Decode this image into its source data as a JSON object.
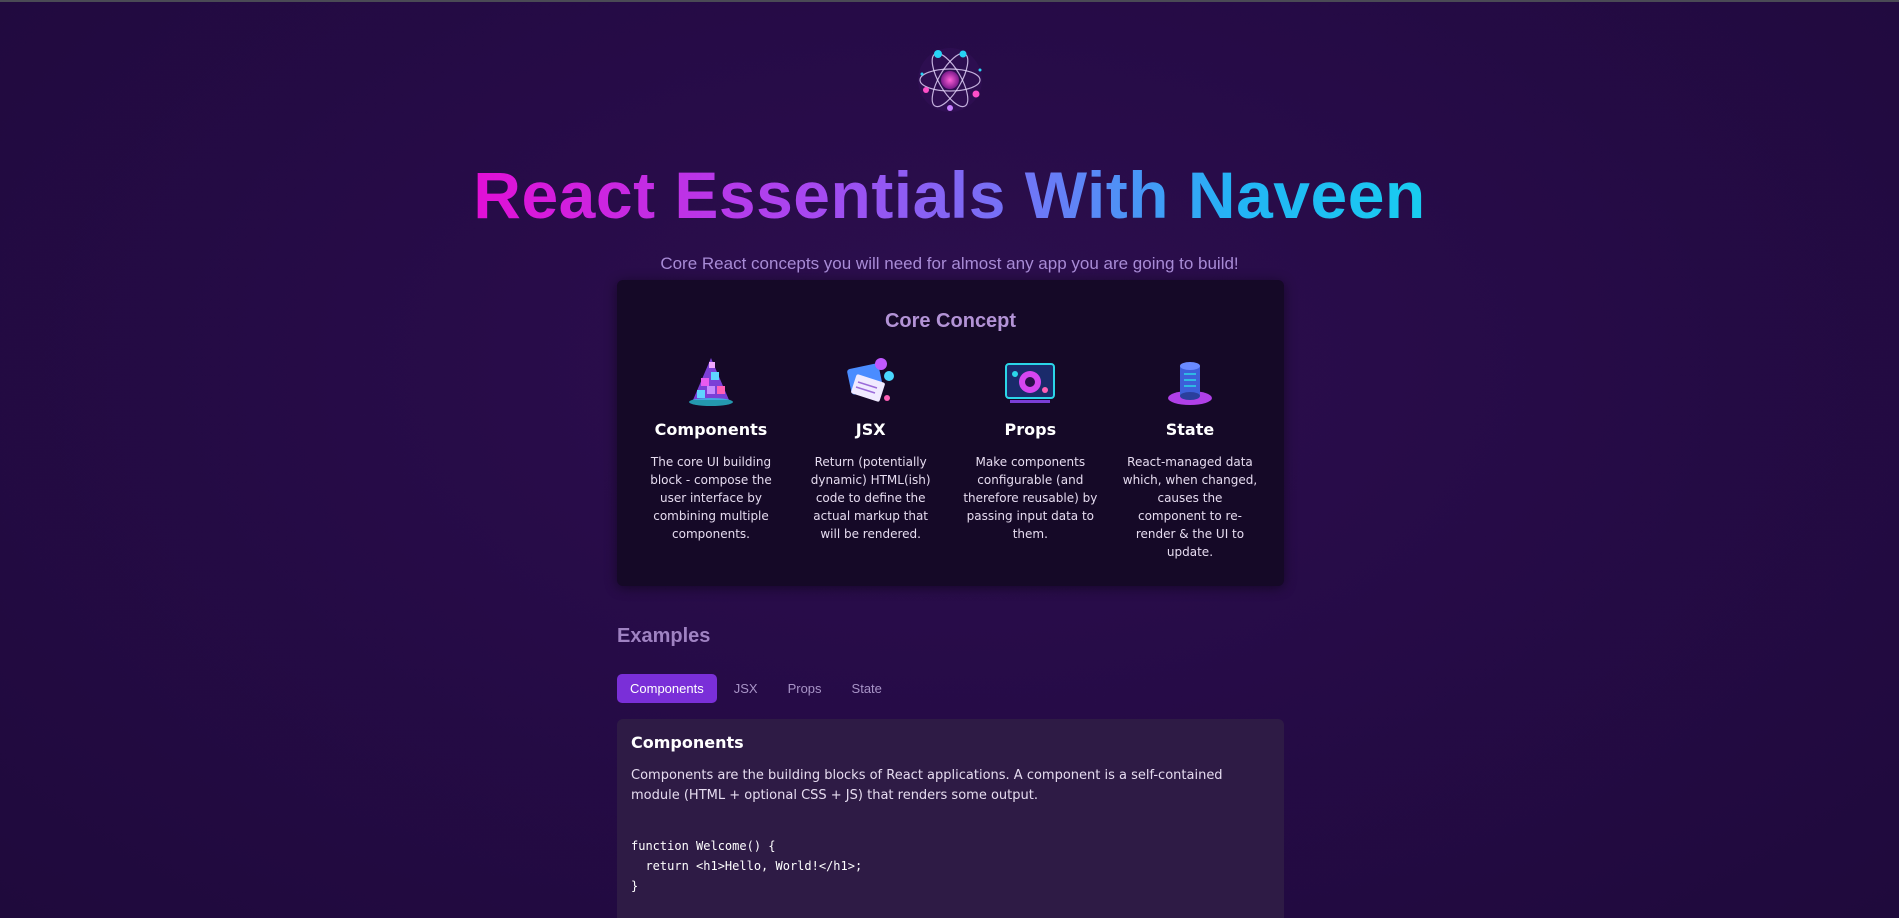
{
  "header": {
    "logo_icon": "react-atom-icon",
    "title": "React Essentials With Naveen",
    "subtitle": "Core React concepts you will need for almost any app you are going to build!"
  },
  "core_concepts": {
    "heading": "Core Concept",
    "items": [
      {
        "icon": "components-icon",
        "title": "Components",
        "description": "The core UI building block - compose the user interface by combining multiple components."
      },
      {
        "icon": "jsx-icon",
        "title": "JSX",
        "description": "Return (potentially dynamic) HTML(ish) code to define the actual markup that will be rendered."
      },
      {
        "icon": "props-icon",
        "title": "Props",
        "description": "Make components configurable (and therefore reusable) by passing input data to them."
      },
      {
        "icon": "state-icon",
        "title": "State",
        "description": "React-managed data which, when changed, causes the component to re-render & the UI to update."
      }
    ]
  },
  "examples": {
    "heading": "Examples",
    "tabs": [
      "Components",
      "JSX",
      "Props",
      "State"
    ],
    "active_tab": "Components",
    "content": {
      "title": "Components",
      "description": "Components are the building blocks of React applications. A component is a self-contained module (HTML + optional CSS + JS) that renders some output.",
      "code": "function Welcome() {\n  return <h1>Hello, World!</h1>;\n}"
    }
  },
  "colors": {
    "background": "#260b47",
    "accent": "#7a2fd8",
    "title_gradient_start": "#e20fd6",
    "title_gradient_end": "#18cdf0"
  }
}
